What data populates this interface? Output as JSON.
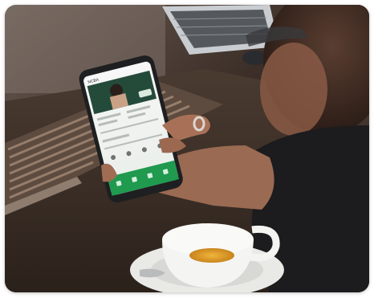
{
  "photo": {
    "subject": "person-holding-smartphone-with-green-app-over-coffee",
    "colors": {
      "table": "#3a2e26",
      "vent": "#7a6455",
      "app_accent": "#1f9a4e",
      "coffee": "#e0a030",
      "cup": "#f4f4f2",
      "sweater": "#1c1b1d",
      "skin": "#b27a5e",
      "phone_frame": "#1e1f21"
    }
  },
  "phone_screen": {
    "header_text": "NCBA",
    "nav_items": [
      "",
      "",
      "",
      ""
    ]
  }
}
